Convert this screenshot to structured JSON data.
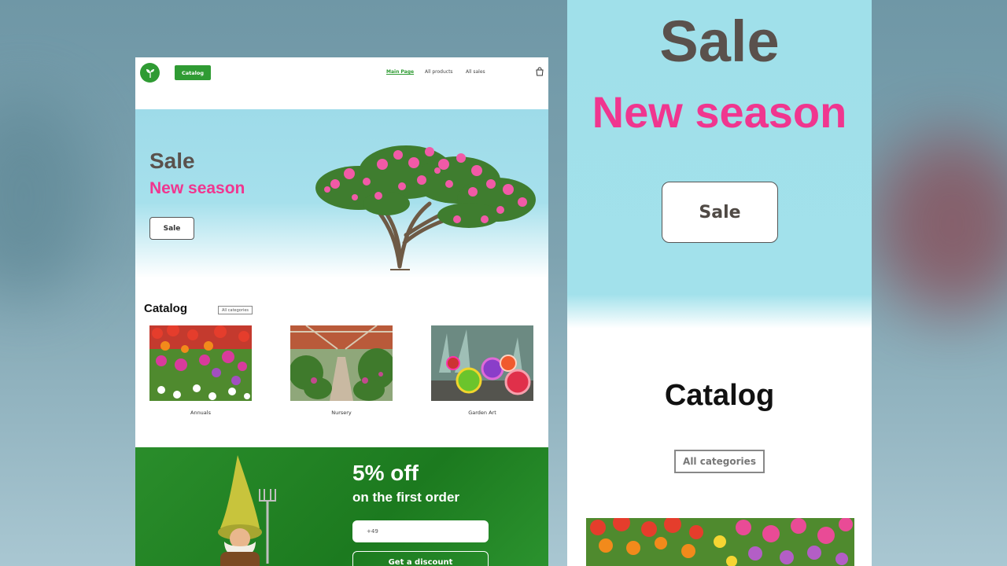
{
  "desktop": {
    "header": {
      "catalog_button": "Catalog",
      "nav": [
        "Main Page",
        "All products",
        "All sales"
      ]
    },
    "hero": {
      "title": "Sale",
      "subtitle": "New season",
      "button": "Sale"
    },
    "catalog": {
      "title": "Catalog",
      "all_button": "All categories",
      "items": [
        {
          "label": "Annuals"
        },
        {
          "label": "Nursery"
        },
        {
          "label": "Garden Art"
        }
      ]
    },
    "promo": {
      "headline": "5% off",
      "subline": "on the first order",
      "phone_value": "+49",
      "button": "Get a discount"
    }
  },
  "mobile": {
    "hero_title": "Sale",
    "hero_subtitle": "New season",
    "hero_button": "Sale",
    "catalog_title": "Catalog",
    "catalog_all_button": "All categories"
  },
  "colors": {
    "accent_green": "#2f9b33",
    "accent_pink": "#f0368f",
    "hero_sky": "#9edbe9",
    "text_dark": "#5a514c"
  },
  "icons": [
    "leaf-logo-icon",
    "shopping-bag-icon"
  ]
}
